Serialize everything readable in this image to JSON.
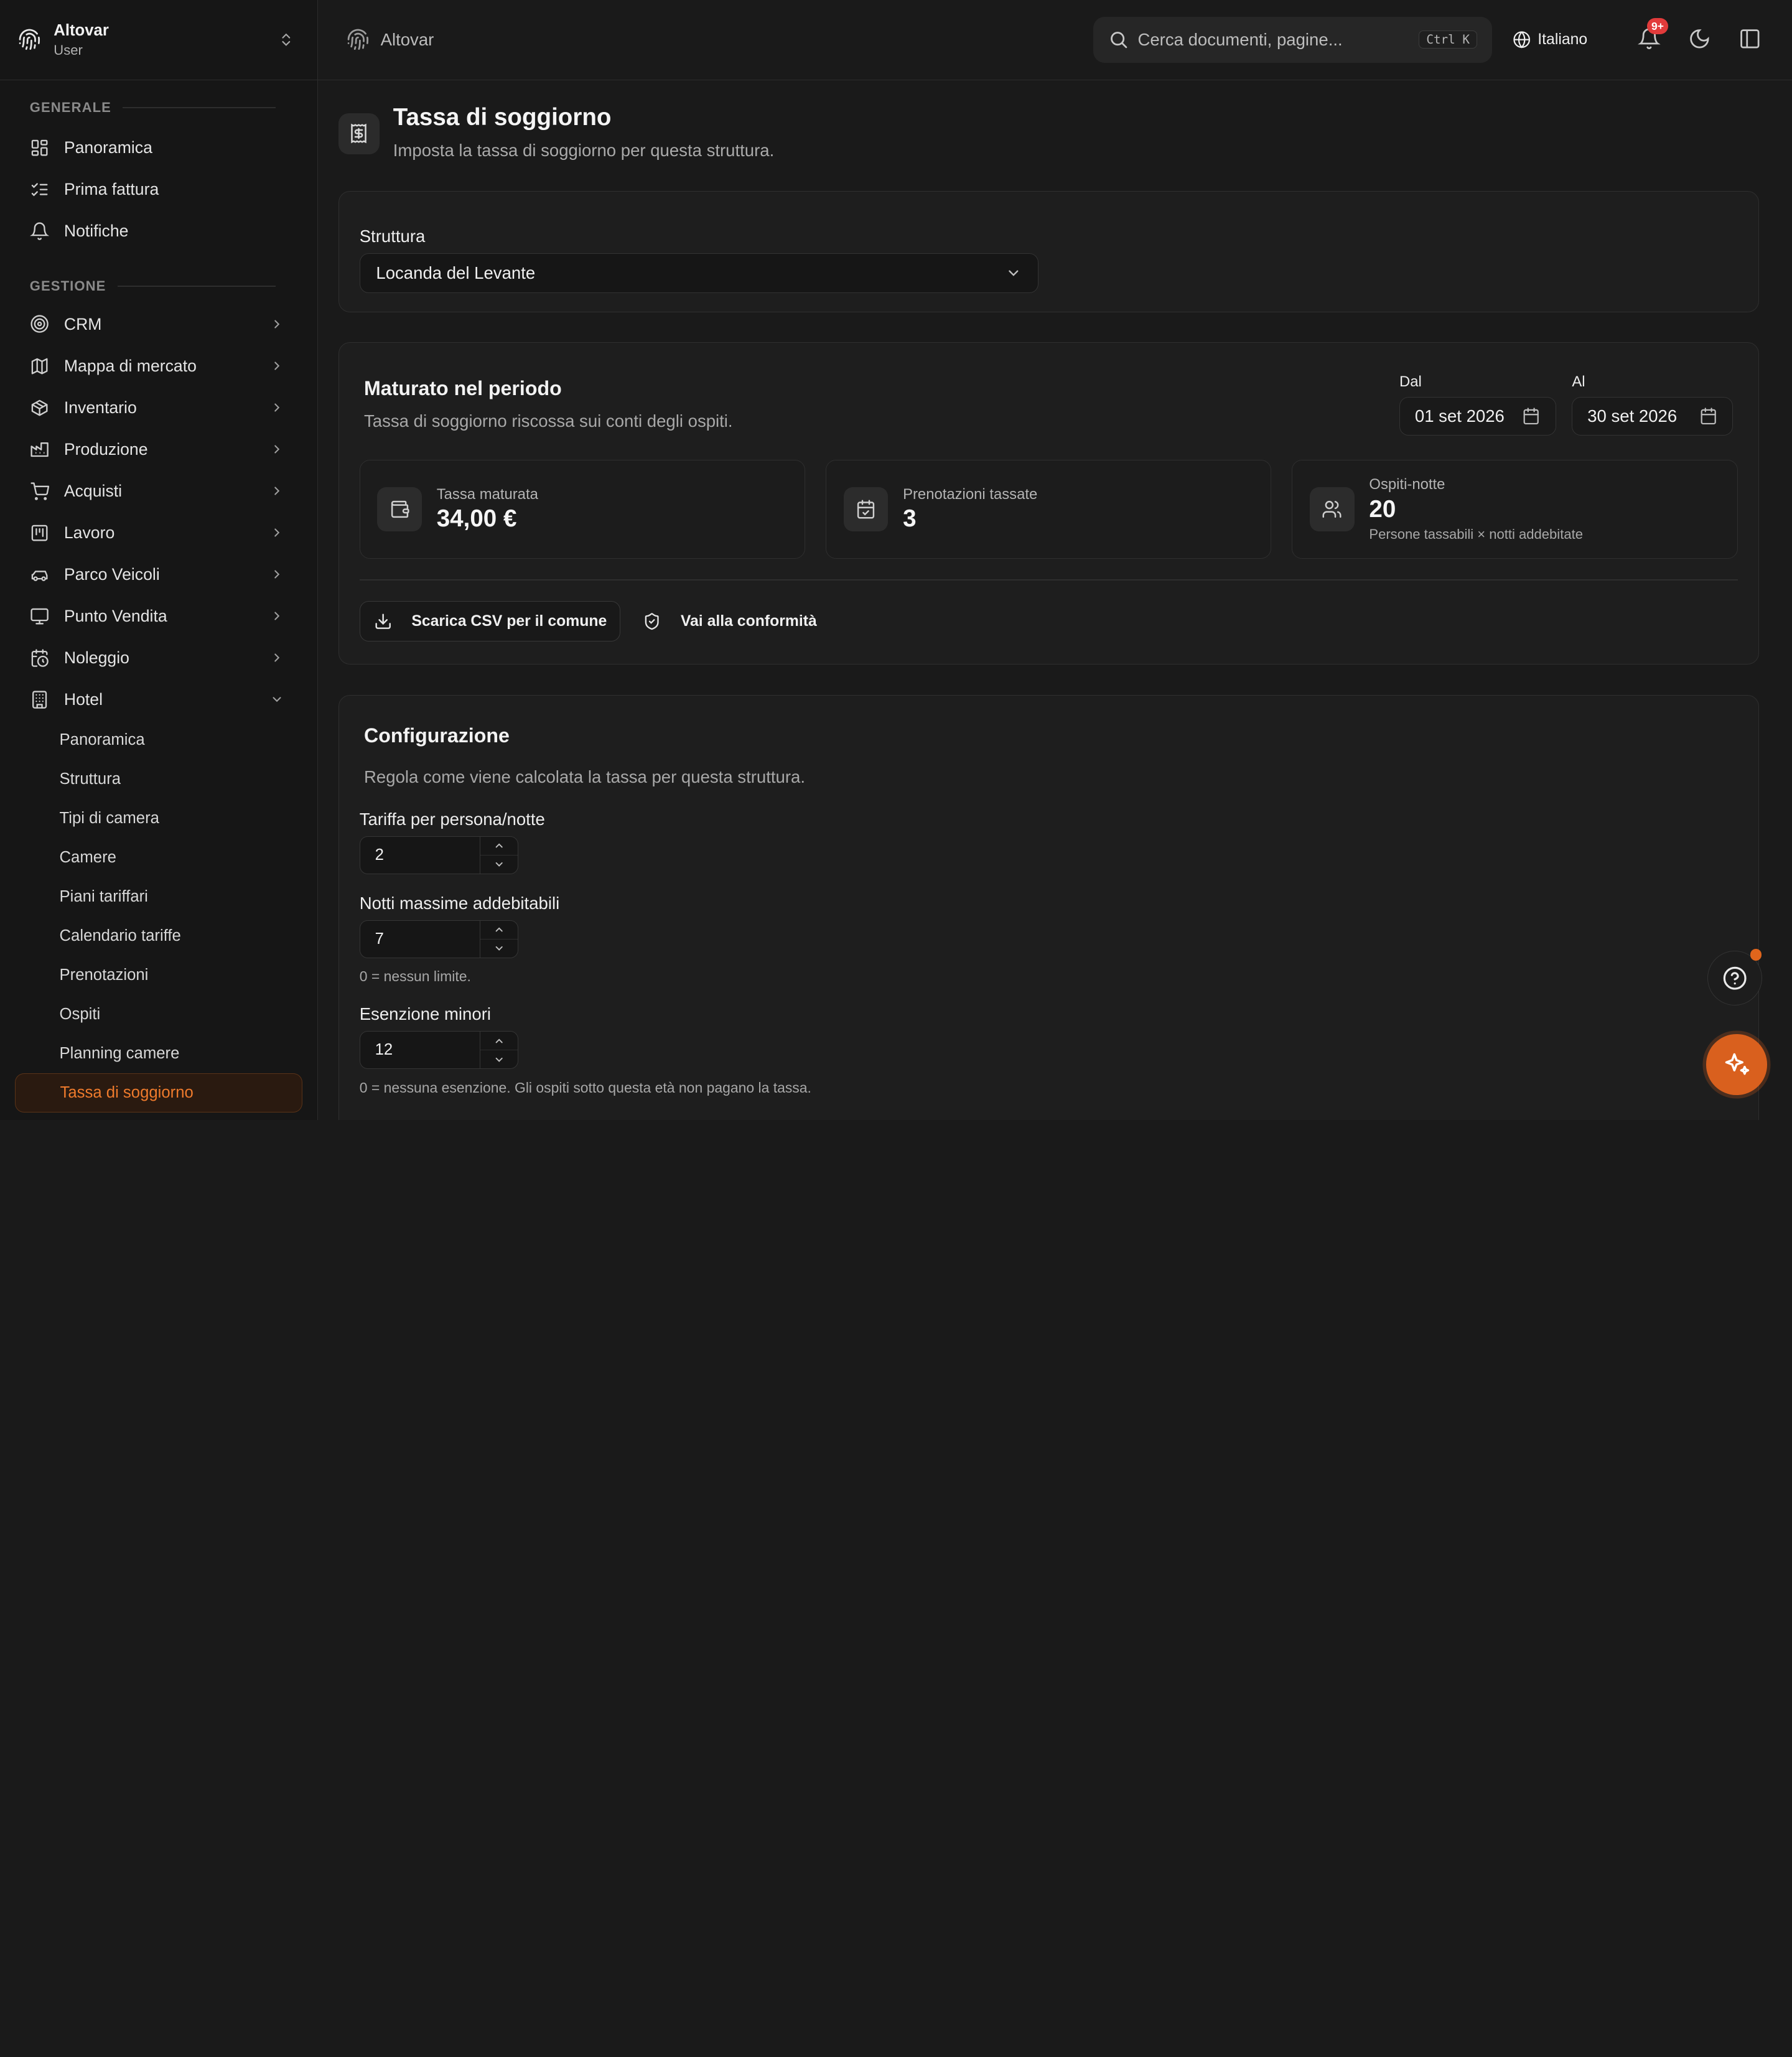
{
  "workspace": {
    "name": "Altovar",
    "role": "User"
  },
  "sidebar": {
    "sections": [
      {
        "label": "GENERALE"
      },
      {
        "label": "GESTIONE"
      }
    ],
    "general": [
      {
        "label": "Panoramica",
        "icon": "dashboard-icon"
      },
      {
        "label": "Prima fattura",
        "icon": "checklist-icon"
      },
      {
        "label": "Notifiche",
        "icon": "bell-icon"
      }
    ],
    "management": [
      {
        "label": "CRM",
        "icon": "target-icon"
      },
      {
        "label": "Mappa di mercato",
        "icon": "map-icon"
      },
      {
        "label": "Inventario",
        "icon": "box-icon"
      },
      {
        "label": "Produzione",
        "icon": "factory-icon"
      },
      {
        "label": "Acquisti",
        "icon": "cart-icon"
      },
      {
        "label": "Lavoro",
        "icon": "kanban-icon"
      },
      {
        "label": "Parco Veicoli",
        "icon": "car-icon"
      },
      {
        "label": "Punto Vendita",
        "icon": "monitor-icon"
      },
      {
        "label": "Noleggio",
        "icon": "calendar-clock-icon"
      },
      {
        "label": "Hotel",
        "icon": "building-icon"
      }
    ],
    "hotel_sub": [
      {
        "label": "Panoramica"
      },
      {
        "label": "Struttura"
      },
      {
        "label": "Tipi di camera"
      },
      {
        "label": "Camere"
      },
      {
        "label": "Piani tariffari"
      },
      {
        "label": "Calendario tariffe"
      },
      {
        "label": "Prenotazioni"
      },
      {
        "label": "Ospiti"
      },
      {
        "label": "Planning camere"
      },
      {
        "label": "Tassa di soggiorno"
      }
    ],
    "active_item": "Tassa di soggiorno"
  },
  "topbar": {
    "breadcrumb": "Altovar",
    "search_placeholder": "Cerca documenti, pagine...",
    "search_shortcut": "Ctrl K",
    "language": "Italiano",
    "notifications_badge": "9+"
  },
  "page": {
    "title": "Tassa di soggiorno",
    "subtitle": "Imposta la tassa di soggiorno per questa struttura."
  },
  "structure": {
    "label": "Struttura",
    "selected": "Locanda del Levante"
  },
  "period": {
    "title": "Maturato nel periodo",
    "subtitle": "Tassa di soggiorno riscossa sui conti degli ospiti.",
    "from_label": "Dal",
    "from_value": "01 set 2026",
    "to_label": "Al",
    "to_value": "30 set 2026",
    "stats": [
      {
        "label": "Tassa maturata",
        "value": "34,00 €",
        "note": ""
      },
      {
        "label": "Prenotazioni tassate",
        "value": "3",
        "note": ""
      },
      {
        "label": "Ospiti-notte",
        "value": "20",
        "note": "Persone tassabili × notti addebitate"
      }
    ],
    "csv_button": "Scarica CSV per il comune",
    "compliance_button": "Vai alla conformità"
  },
  "config": {
    "title": "Configurazione",
    "subtitle": "Regola come viene calcolata la tassa per questa struttura.",
    "fields": [
      {
        "label": "Tariffa per persona/notte",
        "value": "2",
        "hint": ""
      },
      {
        "label": "Notti massime addebitabili",
        "value": "7",
        "hint": "0 = nessun limite."
      },
      {
        "label": "Esenzione minori",
        "value": "12",
        "hint": "0 = nessuna esenzione. Gli ospiti sotto questa età non pagano la tassa."
      }
    ]
  },
  "colors": {
    "accent": "#d9601e",
    "background": "#1a1a1a",
    "sidebar": "#161616",
    "badge": "#e23b3b"
  }
}
